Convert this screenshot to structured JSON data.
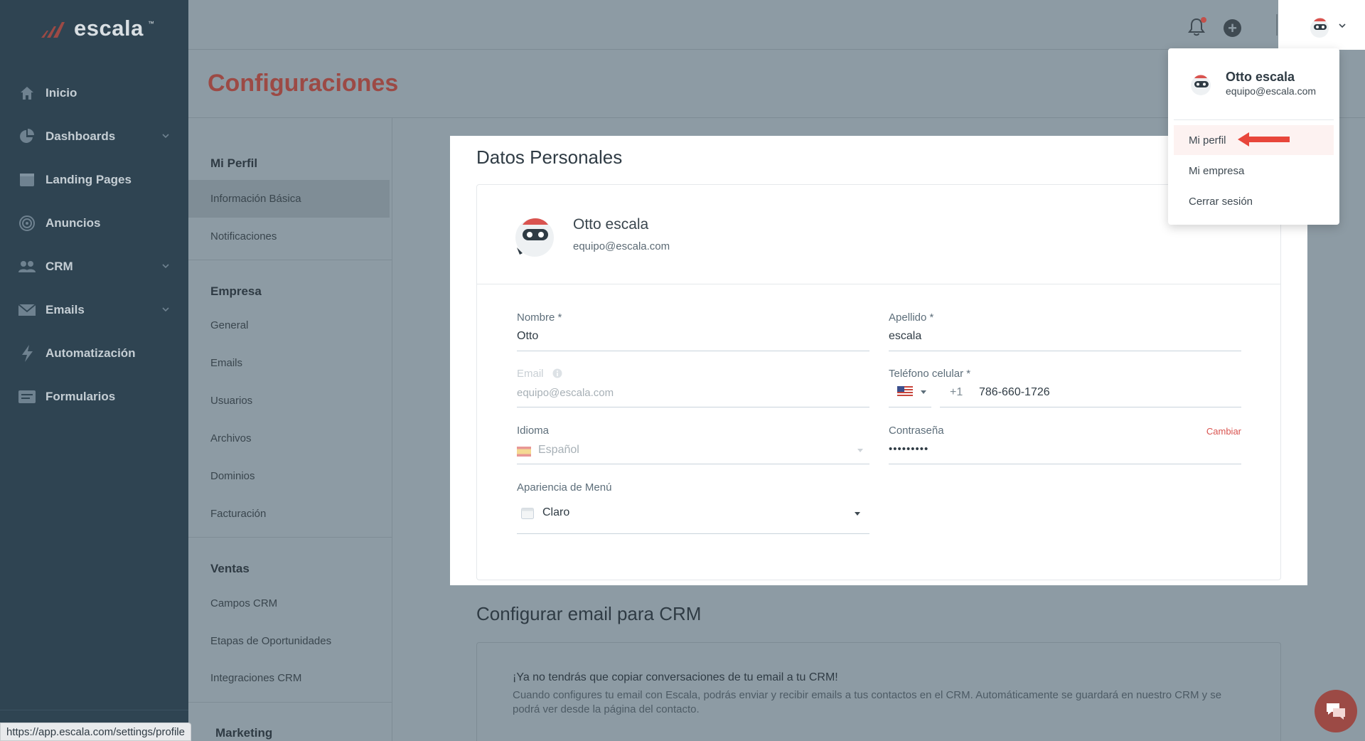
{
  "app": {
    "logo": "escala",
    "logo_tm": "™"
  },
  "sidebar": {
    "items": [
      {
        "label": "Inicio",
        "icon": "home-icon",
        "has_chevron": false
      },
      {
        "label": "Dashboards",
        "icon": "pie-chart-icon",
        "has_chevron": true
      },
      {
        "label": "Landing Pages",
        "icon": "landing-page-icon",
        "has_chevron": false
      },
      {
        "label": "Anuncios",
        "icon": "target-icon",
        "has_chevron": false
      },
      {
        "label": "CRM",
        "icon": "people-icon",
        "has_chevron": true
      },
      {
        "label": "Emails",
        "icon": "envelope-icon",
        "has_chevron": true
      },
      {
        "label": "Automatización",
        "icon": "lightning-icon",
        "has_chevron": false
      },
      {
        "label": "Formularios",
        "icon": "form-icon",
        "has_chevron": false
      }
    ]
  },
  "topbar": {
    "icons": [
      "bell-icon",
      "plus-circle-icon",
      "avatar-icon",
      "chevron-down-icon"
    ]
  },
  "page": {
    "title": "Configuraciones"
  },
  "settings_menu": {
    "mi_perfil": {
      "heading": "Mi Perfil",
      "items": [
        "Información Básica",
        "Notificaciones"
      ],
      "active": "Información Básica"
    },
    "empresa": {
      "heading": "Empresa",
      "items": [
        "General",
        "Emails",
        "Usuarios",
        "Archivos",
        "Dominios",
        "Facturación"
      ]
    },
    "ventas": {
      "heading": "Ventas",
      "items": [
        "Campos CRM",
        "Etapas de Oportunidades",
        "Integraciones CRM"
      ]
    },
    "marketing": {
      "heading": "Marketing"
    }
  },
  "personal": {
    "title": "Datos Personales",
    "profile": {
      "name": "Otto escala",
      "email": "equipo@escala.com"
    },
    "fields": {
      "nombre": {
        "label": "Nombre *",
        "value": "Otto"
      },
      "apellido": {
        "label": "Apellido *",
        "value": "escala"
      },
      "email": {
        "label": "Email",
        "value": "equipo@escala.com"
      },
      "telefono": {
        "label": "Teléfono celular *",
        "prefix": "+1",
        "value": "786-660-1726",
        "flag": "us-flag-icon"
      },
      "idioma": {
        "label": "Idioma",
        "value": "Español",
        "flag": "es-flag-icon"
      },
      "contrasena": {
        "label": "Contraseña",
        "value": "•••••••••",
        "action": "Cambiar"
      },
      "apariencia": {
        "label": "Apariencia de Menú",
        "value": "Claro"
      }
    }
  },
  "crm_email": {
    "title": "Configurar email para CRM",
    "headline": "¡Ya no tendrás que copiar conversaciones de tu email a tu CRM!",
    "description": "Cuando configures tu email con Escala, podrás enviar y recibir emails a tus contactos en el CRM. Automáticamente se guardará en nuestro CRM y se podrá ver desde la página del contacto."
  },
  "dropdown": {
    "name": "Otto escala",
    "email": "equipo@escala.com",
    "items": [
      "Mi perfil",
      "Mi empresa",
      "Cerrar sesión"
    ],
    "highlighted": "Mi perfil"
  },
  "statusbar": {
    "url": "https://app.escala.com/settings/profile"
  },
  "colors": {
    "accent": "#9c4a45",
    "danger": "#d9534f",
    "sidebar": "#2f4452",
    "arrow": "#e8463b"
  }
}
